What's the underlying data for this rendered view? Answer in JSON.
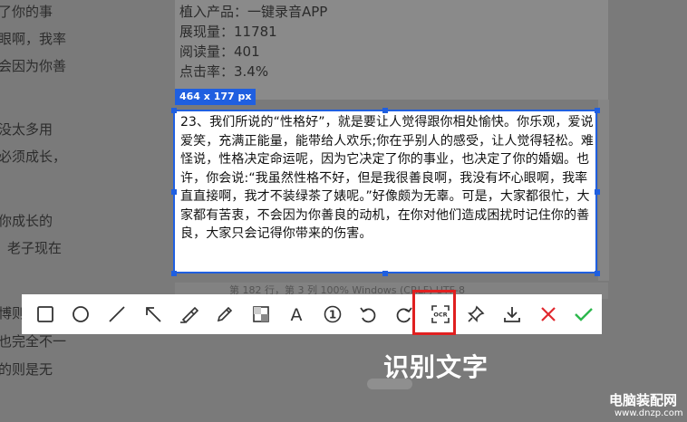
{
  "background_left_lines": [
    "了你的事",
    "眼啊，我率",
    "会因为你善",
    "没太多用",
    "必须成长，",
    "你成长的",
    "老子现在",
    "博则",
    "也完全不一",
    "的则是无"
  ],
  "stats": {
    "line1": "植入产品：一键录音APP",
    "line2": "展现量：11781",
    "line3": "阅读量：401",
    "line4": "点击率：3.4%"
  },
  "status_bar": "第 182 行，第 3 列      100%    Windows (CRLF)    UTF-8",
  "selection": {
    "size_label": "464 x 177 px",
    "text": "23、我们所说的“性格好”，就是要让人觉得跟你相处愉快。你乐观，爱说爱笑，充满正能量，能带给人欢乐;你在乎别人的感受，让人觉得轻松。难怪说，性格决定命运呢，因为它决定了你的事业，也决定了你的婚姻。也许，你会说:“我虽然性格不好，但是我很善良啊，我没有坏心眼啊，我率直直接啊，我才不装绿茶了婊呢。”好像颇为无辜。可是，大家都很忙，大家都有苦衷，不会因为你善良的动机，在你对他们造成困扰时记住你的善良，大家只会记得你带来的伤害。"
  },
  "toolbar": {
    "ocr_glyph": "OCR",
    "number_glyph": "1",
    "text_glyph": "A",
    "icons": [
      "rectangle-icon",
      "ellipse-icon",
      "line-icon",
      "arrow-icon",
      "marker-icon",
      "pencil-icon",
      "mosaic-icon",
      "text-icon",
      "number-icon",
      "undo-icon",
      "redo-icon",
      "ocr-icon",
      "pin-icon",
      "download-icon",
      "close-icon",
      "confirm-icon"
    ]
  },
  "colors": {
    "accent": "#1f5fe0",
    "highlight": "#e02020",
    "cancel": "#e0282e",
    "confirm": "#2db84d"
  },
  "caption": "识别文字",
  "watermark": {
    "name": "电脑装配网",
    "url": "www.dnzp.com"
  }
}
